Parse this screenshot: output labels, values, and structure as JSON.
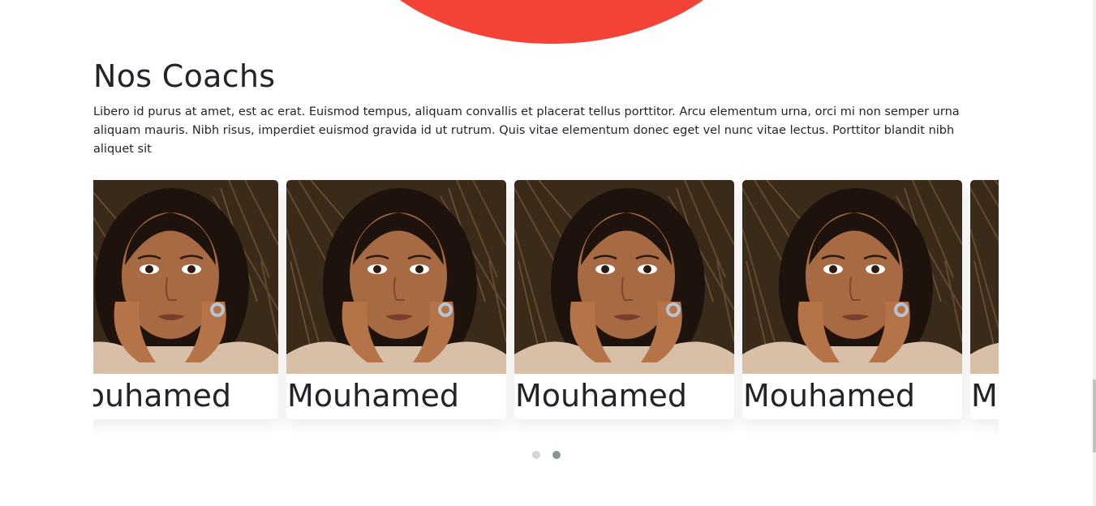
{
  "section": {
    "title": "Nos Coachs",
    "description": "Libero id purus at amet, est ac erat. Euismod tempus, aliquam convallis et placerat tellus porttitor. Arcu elementum urna, orci mi non semper urna aliquam mauris. Nibh risus, imperdiet euismod gravida id ut rutrum. Quis vitae elementum donec eget vel nunc vitae lectus. Porttitor blandit nibh aliquet sit"
  },
  "coaches": [
    {
      "name": "Mouhamed",
      "photo_icon": "coach-photo"
    },
    {
      "name": "Mouhamed",
      "photo_icon": "coach-photo"
    },
    {
      "name": "Mouhamed",
      "photo_icon": "coach-photo"
    },
    {
      "name": "Mouhamed",
      "photo_icon": "coach-photo"
    },
    {
      "name": "Mouhamed",
      "photo_icon": "coach-photo"
    }
  ],
  "carousel": {
    "pages": 2,
    "active_page": 2
  },
  "colors": {
    "accent": "#f44336",
    "text": "#212529",
    "dot_inactive": "#d6d6d6",
    "dot_active": "#869791"
  }
}
